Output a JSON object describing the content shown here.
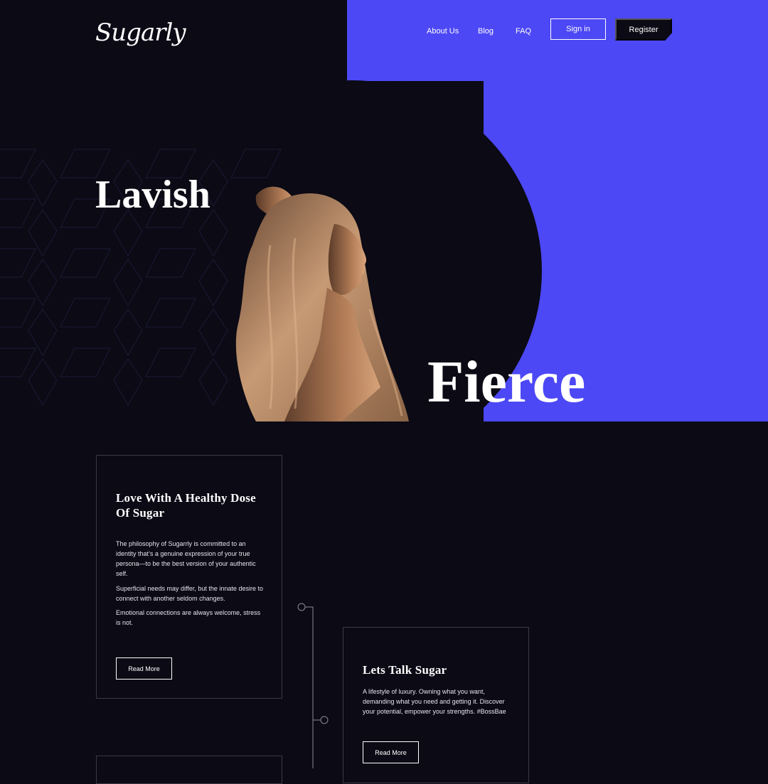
{
  "brand": {
    "logo_text": "Sugarly",
    "accent_color": "#4c48f5",
    "bg_color": "#0b0a15"
  },
  "nav": {
    "links": [
      "About Us",
      "Blog",
      "FAQ"
    ],
    "signin_label": "Sign in",
    "register_label": "Register"
  },
  "hero": {
    "word_top": "Lavish",
    "word_bottom": "Fierce"
  },
  "cards": [
    {
      "title_line1": "Love With A Healthy Dose",
      "title_line2": "Of Sugar",
      "paragraphs": [
        "The philosophy of Sugarrly is committed to an identity that’s a genuine expression of your true persona—to be the best version of your authentic self.",
        "Superficial needs may differ, but the innate desire to connect with another seldom changes.",
        "Emotional connections are always welcome, stress is not."
      ],
      "button_label": "Read More"
    },
    {
      "title_line1": "Lets Talk Sugar",
      "paragraphs": [
        "A lifestyle of luxury. Owning what you want, demanding what you need and getting it. Discover your potential, empower your strengths. #BossBae"
      ],
      "button_label": "Read More"
    }
  ]
}
